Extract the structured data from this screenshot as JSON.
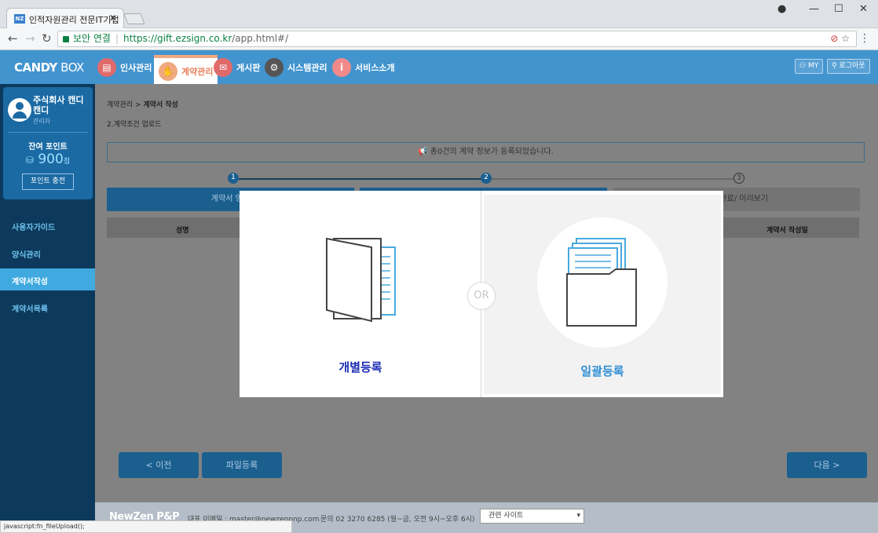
{
  "browser": {
    "tab_title": "인적자원관리 전문IT기업",
    "favicon_text": "NZ",
    "secure_label": "보안 연결",
    "url_host": "https://gift.ezsign.co.kr",
    "url_path": "/app.html#/",
    "status_text": "javascript:fn_fileUpload();"
  },
  "header": {
    "logo_bold": "CANDY",
    "logo_light": " BOX",
    "menu": [
      {
        "label": "인사관리",
        "icon": "id-card-icon",
        "color": "#e06a6a"
      },
      {
        "label": "계약관리",
        "icon": "handshake-icon",
        "color": "#f0a880"
      },
      {
        "label": "게시판",
        "icon": "chat-icon",
        "color": "#e06a6a"
      },
      {
        "label": "시스템관리",
        "icon": "gear-icon",
        "color": "#555555"
      },
      {
        "label": "서비스소개",
        "icon": "info-icon",
        "color": "#f08a8a"
      }
    ],
    "my_label": "MY",
    "logout_label": "로그아웃"
  },
  "sidebar": {
    "company": "주식회사 캔디 캔디",
    "role": "관리자",
    "points_label": "잔여 포인트",
    "points_value": "900",
    "points_unit": "점",
    "charge_label": "포인트 충전",
    "items": [
      {
        "label": "사용자가이드"
      },
      {
        "label": "양식관리"
      },
      {
        "label": "계약서작성"
      },
      {
        "label": "계약서목록"
      }
    ]
  },
  "main": {
    "breadcrumb_parent": "계약관리 > ",
    "breadcrumb_current": "계약서 작성",
    "subtitle": "2.계약조건 업로드",
    "notice": "총0건의 계약 정보가 등록되었습니다.",
    "steps": [
      "1",
      "2",
      "3"
    ],
    "tab1_label": "계약서 양식",
    "tab3_label": "작성완료/ 미리보기",
    "col_name": "성명",
    "col_date": "계약서 작성일",
    "prev_button": "< 이전",
    "file_button": "파일등록",
    "next_button": "다음 >"
  },
  "footer": {
    "logo": "NewZen P&P",
    "email": "대표 이메일 : master@newzenpnp.com",
    "phone": "문의 02 3270 6285 (월~금, 오전 9시~오후 6시)",
    "related_sites": "관련 사이트"
  },
  "modal": {
    "individual_label": "개별등록",
    "bulk_label": "일괄등록",
    "or_label": "OR",
    "individual_color": "#1a2db5",
    "bulk_color": "#2f8fd6"
  }
}
